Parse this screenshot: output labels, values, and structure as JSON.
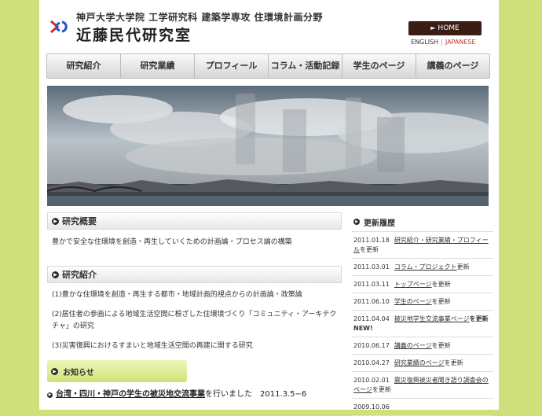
{
  "header": {
    "subtitle": "神戸大学大学院 工学研究科 建築学専攻 住環境計画分野",
    "lab_name": "近藤民代研究室",
    "home_label": "HOME",
    "lang_en": "ENGLISH",
    "lang_ja": "JAPANESE"
  },
  "nav": [
    "研究紹介",
    "研究業績",
    "プロフィール",
    "コラム・活動記録",
    "学生のページ",
    "講義のページ"
  ],
  "overview": {
    "title": "研究概要",
    "text": "豊かで安全な住環境を創造・再生していくための計画論・プロセス論の構築"
  },
  "research": {
    "title": "研究紹介",
    "items": [
      "(1)豊かな住環境を創造・再生する都市・地域計画的視点からの計画論・政策論",
      "(2)居住者の参画による地域生活空間に根ざした住環境づくり「コミュニティ・アーキテクチャ」の研究",
      "(3)災害復興におけるすまいと地域生活空間の再建に関する研究"
    ]
  },
  "news": {
    "title": "お知らせ",
    "item_link": "台湾・四川・神戸の学生の被災地交流事業",
    "item_tail": "を行いました　2011.3.5−6"
  },
  "updates": {
    "title": "更新履歴",
    "entries": [
      {
        "date": "2011.01.18",
        "link": "研究紹介・研究業績・プロフィール",
        "tail": "を更新"
      },
      {
        "date": "2011.03.01",
        "link": "コラム・プロジェクト",
        "tail": "更新"
      },
      {
        "date": "2011.03.11",
        "link": "トップページ",
        "tail": "を更新"
      },
      {
        "date": "2011.06.10",
        "link": "学生のページ",
        "tail": "を更新"
      },
      {
        "date": "2011.04.04",
        "link": "被災地学生交流事業ページ",
        "tail": "を更新 NEW!"
      },
      {
        "date": "2010.06.17",
        "link": "講義のページ",
        "tail": "を更新"
      },
      {
        "date": "2010.04.27",
        "link": "研究業績のページ",
        "tail": "を更新"
      },
      {
        "date": "2010.02.01",
        "link": "震災復興被災者聞き語り調査会のページ",
        "tail": "を更新"
      },
      {
        "date": "2009.10.06",
        "link": "",
        "tail": ""
      }
    ]
  },
  "colors": {
    "accent": "#3a1d14",
    "background": "#cfe07a",
    "japanese": "#c0392b"
  }
}
